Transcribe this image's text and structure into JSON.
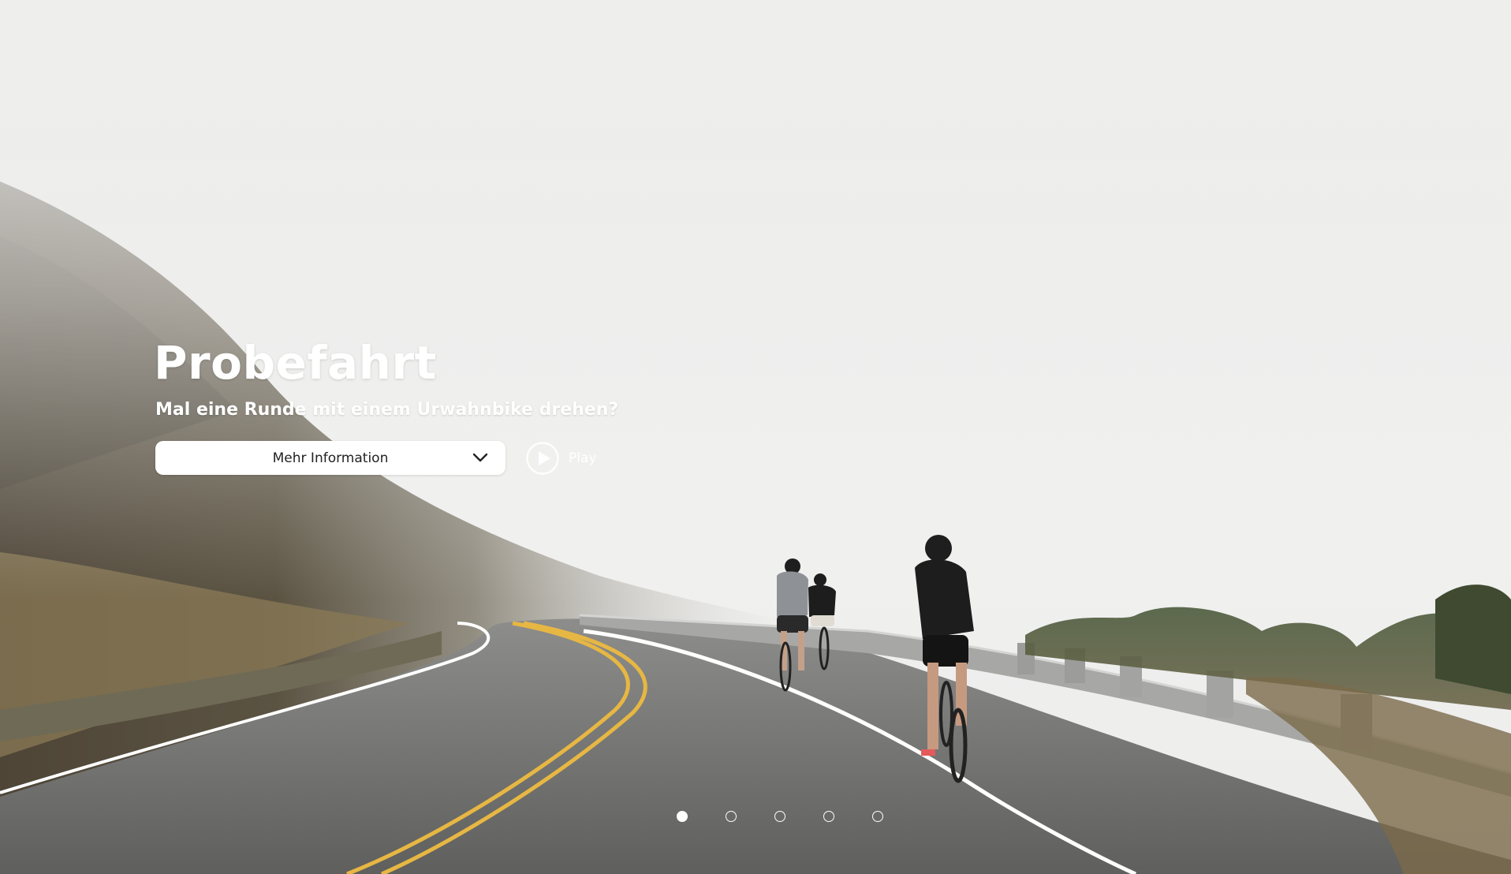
{
  "hero": {
    "title": "Probefahrt",
    "subtitle": "Mal eine Runde mit einem Urwahnbike drehen?",
    "more_info_label": "Mehr Information",
    "play_label": "Play"
  },
  "carousel": {
    "slide_count": 5,
    "active_index": 0
  },
  "icons": {
    "dropdown": "chevron-down-icon",
    "play": "play-icon"
  },
  "colors": {
    "text": "#ffffff",
    "button_bg": "#ffffff",
    "button_text": "#222222",
    "sky": "#ededec",
    "road": "#6f6f6d",
    "center_line": "#e7b743"
  }
}
